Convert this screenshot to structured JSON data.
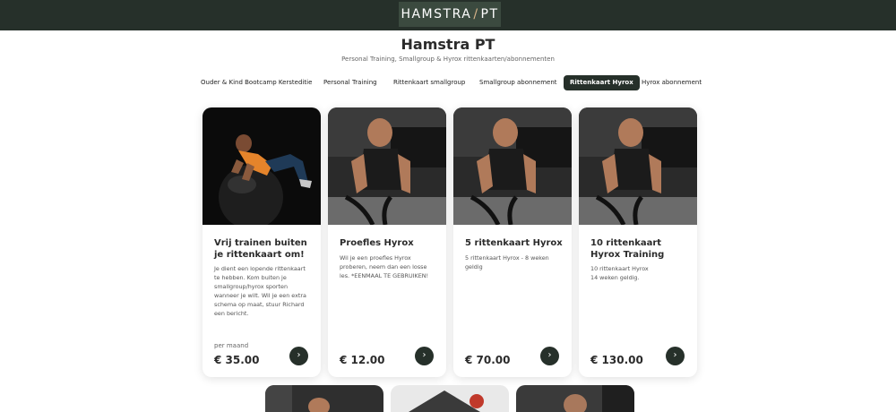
{
  "header": {
    "logo_left": "HAMSTRA",
    "logo_slash": "/",
    "logo_right": "PT"
  },
  "page": {
    "title": "Hamstra PT",
    "subtitle": "Personal Training, Smallgroup & Hyrox rittenkaarten/abonnementen"
  },
  "tabs": [
    {
      "label": "Ouder & Kind Bootcamp Kersteditie"
    },
    {
      "label": "Personal Training"
    },
    {
      "label": "Rittenkaart smallgroup"
    },
    {
      "label": "Smallgroup abonnement"
    },
    {
      "label": "Rittenkaart Hyrox",
      "active": true
    },
    {
      "label": "Hyrox abonnement"
    }
  ],
  "cards": [
    {
      "title": "Vrij trainen buiten je rittenkaart om!",
      "description": "Je dient een lopende rittenkaart te hebben. Kom buiten je smallgroup/hyrox sporten wanneer je wilt. Wil je een extra schema op maat, stuur Richard een bericht.",
      "period": "per maand",
      "price": "€ 35.00",
      "button_icon": "›"
    },
    {
      "title": "Proefles Hyrox",
      "description": "Wil je een proefles Hyrox proberen, neem dan een losse les. *EENMAAL TE GEBRUIKEN!",
      "price": "€ 12.00",
      "button_icon": "›"
    },
    {
      "title": "5 rittenkaart Hyrox",
      "description": "5 rittenkaart Hyrox - 8 weken geldig",
      "price": "€ 70.00",
      "button_icon": "›"
    },
    {
      "title": "10 rittenkaart Hyrox Training",
      "description_lines": [
        "10 rittenkaart Hyrox",
        "14 weken geldig."
      ],
      "price": "€ 130.00",
      "button_icon": "›"
    }
  ],
  "colors": {
    "topbar": "#26302a",
    "accent": "#26302a",
    "logo_box": "#3b4a3f",
    "logo_slash": "#d8b58a"
  }
}
